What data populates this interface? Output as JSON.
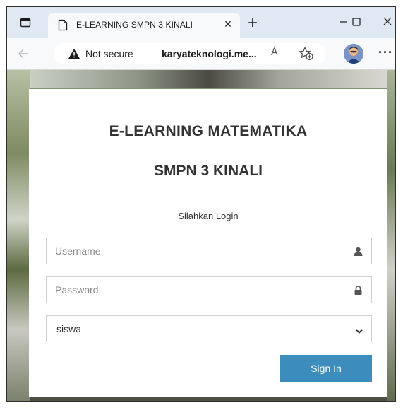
{
  "browser": {
    "tab_title": "E-LEARNING SMPN 3 KINALI",
    "tab_close_glyph": "×",
    "new_tab_glyph": "+",
    "security_label": "Not secure",
    "url": "karyateknologi.me...",
    "read_aloud_glyph": "Á",
    "more_glyph": "···",
    "icons": [
      "tab-actions-icon",
      "page-icon",
      "close-icon",
      "plus-icon",
      "minimize-icon",
      "maximize-icon",
      "window-close-icon",
      "back-arrow-icon",
      "warning-icon",
      "read-aloud-icon",
      "add-favorite-icon",
      "profile-avatar",
      "more-icon"
    ]
  },
  "login": {
    "title_line1": "E-LEARNING MATEMATIKA",
    "title_line2": "SMPN 3 KINALI",
    "subtitle": "Silahkan Login",
    "username_placeholder": "Username",
    "password_placeholder": "Password",
    "role_selected": "siswa",
    "signin_label": "Sign In",
    "icons": [
      "user-icon",
      "lock-icon",
      "chevron-down-icon"
    ]
  },
  "colors": {
    "primary_button": "#3c8dbc",
    "tab_strip": "#dfe8f3",
    "toolbar": "#f7f9fb"
  }
}
